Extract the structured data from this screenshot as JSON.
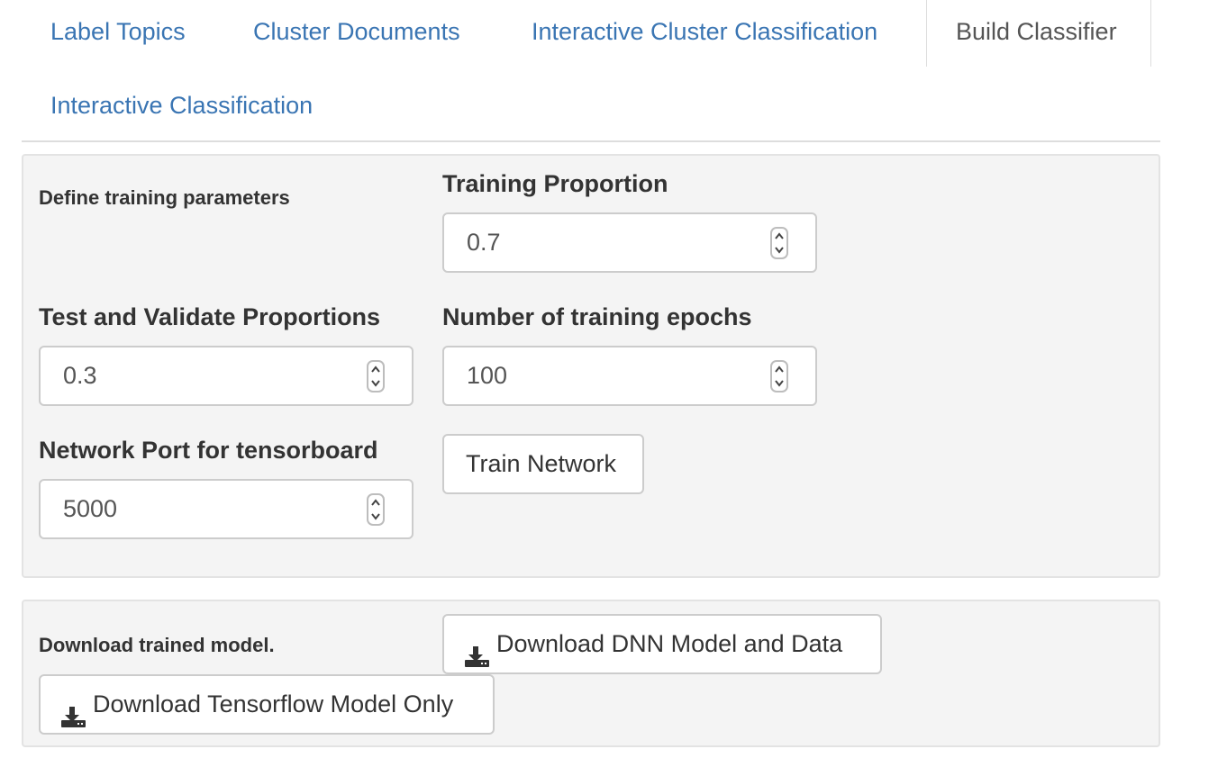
{
  "tabs": [
    {
      "label": "Label Topics",
      "active": false
    },
    {
      "label": "Cluster Documents",
      "active": false
    },
    {
      "label": "Interactive Cluster Classification",
      "active": false
    },
    {
      "label": "Build Classifier",
      "active": true
    },
    {
      "label": "Interactive Classification",
      "active": false
    }
  ],
  "training": {
    "heading": "Define training parameters",
    "training_proportion": {
      "label": "Training Proportion",
      "value": "0.7"
    },
    "test_validate": {
      "label": "Test and Validate Proportions",
      "value": "0.3"
    },
    "epochs": {
      "label": "Number of training epochs",
      "value": "100"
    },
    "port": {
      "label": "Network Port for tensorboard",
      "value": "5000"
    },
    "train_button": "Train Network"
  },
  "download": {
    "heading": "Download trained model.",
    "dnn_button": "Download DNN Model and Data",
    "tf_button": "Download Tensorflow Model Only",
    "icon": "download-icon"
  },
  "colors": {
    "link": "#3a75b3",
    "well_bg": "#f4f4f4",
    "border": "#cccccc"
  }
}
